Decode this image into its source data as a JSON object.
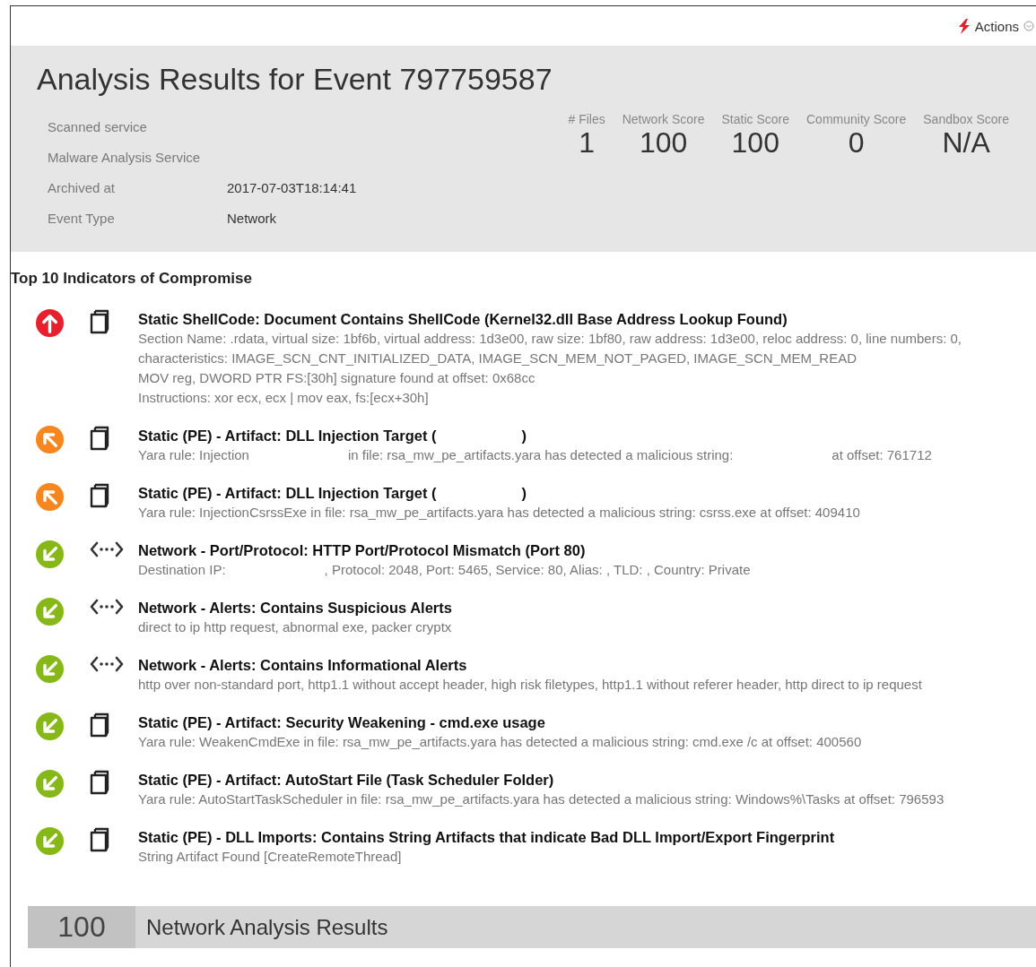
{
  "actions": {
    "label": "Actions"
  },
  "title": "Analysis Results for Event 797759587",
  "info": [
    {
      "label": "Scanned service"
    },
    {
      "label": "Malware Analysis Service"
    },
    {
      "label": "Archived at",
      "value": "2017-07-03T18:14:41"
    },
    {
      "label": "Event Type",
      "value": "Network"
    }
  ],
  "scores": [
    {
      "label": "# Files",
      "value": "1"
    },
    {
      "label": "Network Score",
      "value": "100"
    },
    {
      "label": "Static Score",
      "value": "100"
    },
    {
      "label": "Community Score",
      "value": "0"
    },
    {
      "label": "Sandbox Score",
      "value": "N/A"
    }
  ],
  "indicators_title": "Top 10 Indicators of Compromise",
  "indicators": [
    {
      "kind": "high-file",
      "title": [
        "Static ShellCode: Document Contains ShellCode (Kernel32.dll Base Address Lookup Found)"
      ],
      "lines": [
        [
          "Section Name: .rdata, virtual size: 1bf6b, virtual address: 1d3e00, raw size: 1bf80, raw address: 1d3e00, reloc address: 0, line numbers: 0, characteristics: IMAGE_SCN_CNT_INITIALIZED_DATA, IMAGE_SCN_MEM_NOT_PAGED, IMAGE_SCN_MEM_READ"
        ],
        [
          "MOV reg, DWORD PTR FS:[30h] signature found at offset: 0x68cc"
        ],
        [
          "Instructions: xor ecx, ecx | mov eax, fs:[ecx+30h]"
        ]
      ]
    },
    {
      "kind": "medium-file",
      "title": [
        "Static (PE) - Artifact: DLL Injection Target (",
        ")"
      ],
      "lines": [
        [
          "Yara rule: Injection",
          "in file: rsa_mw_pe_artifacts.yara has detected a malicious string:",
          "at offset: 761712"
        ]
      ]
    },
    {
      "kind": "medium-file",
      "title": [
        "Static (PE) - Artifact: DLL Injection Target (",
        ")"
      ],
      "lines": [
        [
          "Yara rule: InjectionCsrssExe in file: rsa_mw_pe_artifacts.yara has detected a malicious string: csrss.exe at offset: 409410"
        ]
      ]
    },
    {
      "kind": "low-network",
      "title": [
        "Network - Port/Protocol: HTTP Port/Protocol Mismatch (Port 80)"
      ],
      "lines": [
        [
          "Destination IP:",
          ", Protocol: 2048, Port: 5465, Service: 80, Alias: , TLD: , Country: Private"
        ]
      ]
    },
    {
      "kind": "low-network",
      "title": [
        "Network - Alerts: Contains Suspicious Alerts"
      ],
      "lines": [
        [
          "direct to ip http request, abnormal exe, packer cryptx"
        ]
      ]
    },
    {
      "kind": "low-network",
      "title": [
        "Network - Alerts: Contains Informational Alerts"
      ],
      "lines": [
        [
          "http over non-standard port, http1.1 without accept header, high risk filetypes, http1.1 without referer header, http direct to ip request"
        ]
      ]
    },
    {
      "kind": "low-file",
      "title": [
        "Static (PE) - Artifact: Security Weakening - cmd.exe usage"
      ],
      "lines": [
        [
          "Yara rule: WeakenCmdExe in file: rsa_mw_pe_artifacts.yara has detected a malicious string: cmd.exe /c at offset: 400560"
        ]
      ]
    },
    {
      "kind": "low-file",
      "title": [
        "Static (PE) - Artifact: AutoStart File (Task Scheduler Folder)"
      ],
      "lines": [
        [
          "Yara rule: AutoStartTaskScheduler in file: rsa_mw_pe_artifacts.yara has detected a malicious string: Windows%\\Tasks at offset: 796593"
        ]
      ]
    },
    {
      "kind": "low-file",
      "title": [
        "Static (PE) - DLL Imports: Contains String Artifacts that indicate Bad DLL Import/Export Fingerprint"
      ],
      "lines": [
        [
          "String Artifact Found [CreateRemoteThread]"
        ]
      ]
    }
  ],
  "section": {
    "score": "100",
    "title": "Network Analysis Results"
  }
}
